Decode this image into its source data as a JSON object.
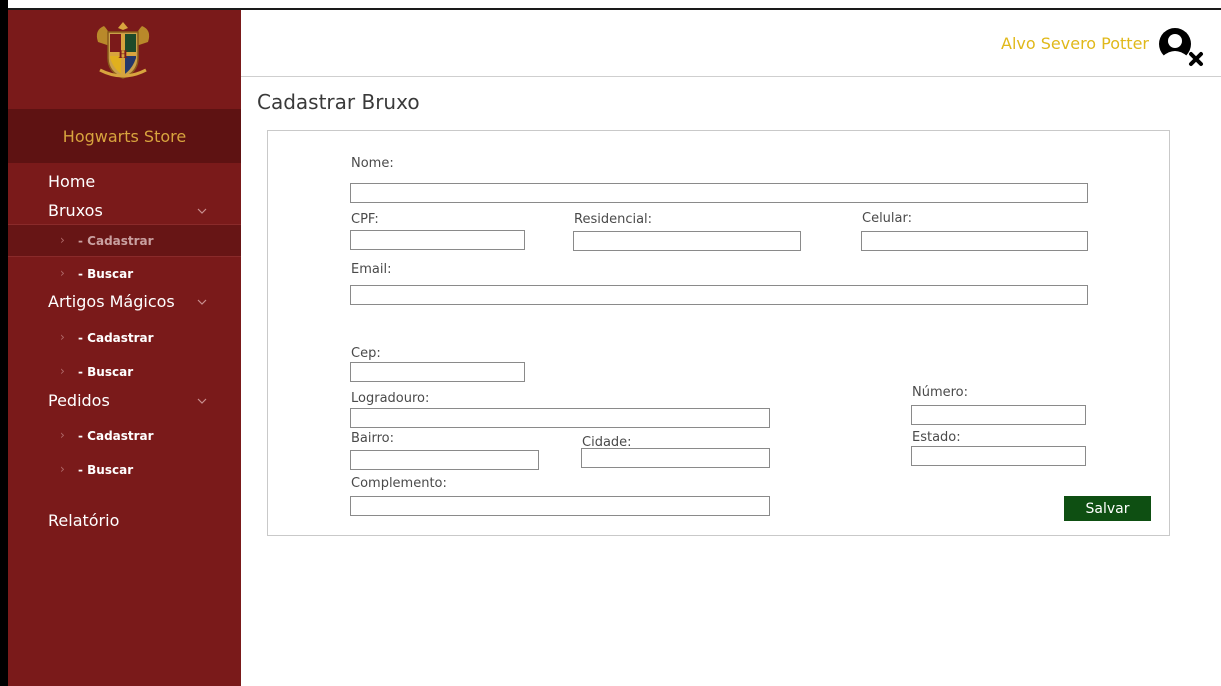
{
  "app": {
    "brand": "Hogwarts Store",
    "user_name": "Alvo Severo Potter"
  },
  "sidebar": {
    "home": "Home",
    "bruxos": "Bruxos",
    "bruxos_cadastrar": "- Cadastrar",
    "bruxos_buscar": "- Buscar",
    "artigos": "Artigos Mágicos",
    "artigos_cadastrar": "- Cadastrar",
    "artigos_buscar": "- Buscar",
    "pedidos": "Pedidos",
    "pedidos_cadastrar": "- Cadastrar",
    "pedidos_buscar": "- Buscar",
    "relatorio": "Relatório"
  },
  "page": {
    "title": "Cadastrar Bruxo"
  },
  "form": {
    "nome": "Nome:",
    "cpf": "CPF:",
    "residencial": "Residencial:",
    "celular": "Celular:",
    "email": "Email:",
    "cep": "Cep:",
    "logradouro": "Logradouro:",
    "numero": "Número:",
    "bairro": "Bairro:",
    "cidade": "Cidade:",
    "estado": "Estado:",
    "complemento": "Complemento:",
    "save_label": "Salvar"
  },
  "icons": {
    "crest": "hogwarts-crest-icon",
    "chevron": "chevron-down-icon",
    "arrow": "chevron-right-icon",
    "avatar": "user-remove-icon"
  },
  "colors": {
    "sidebar_bg": "#7a1a1a",
    "brand_text": "#d8a43e",
    "user_text": "#e0b81a",
    "save_button": "#0e4f12"
  }
}
